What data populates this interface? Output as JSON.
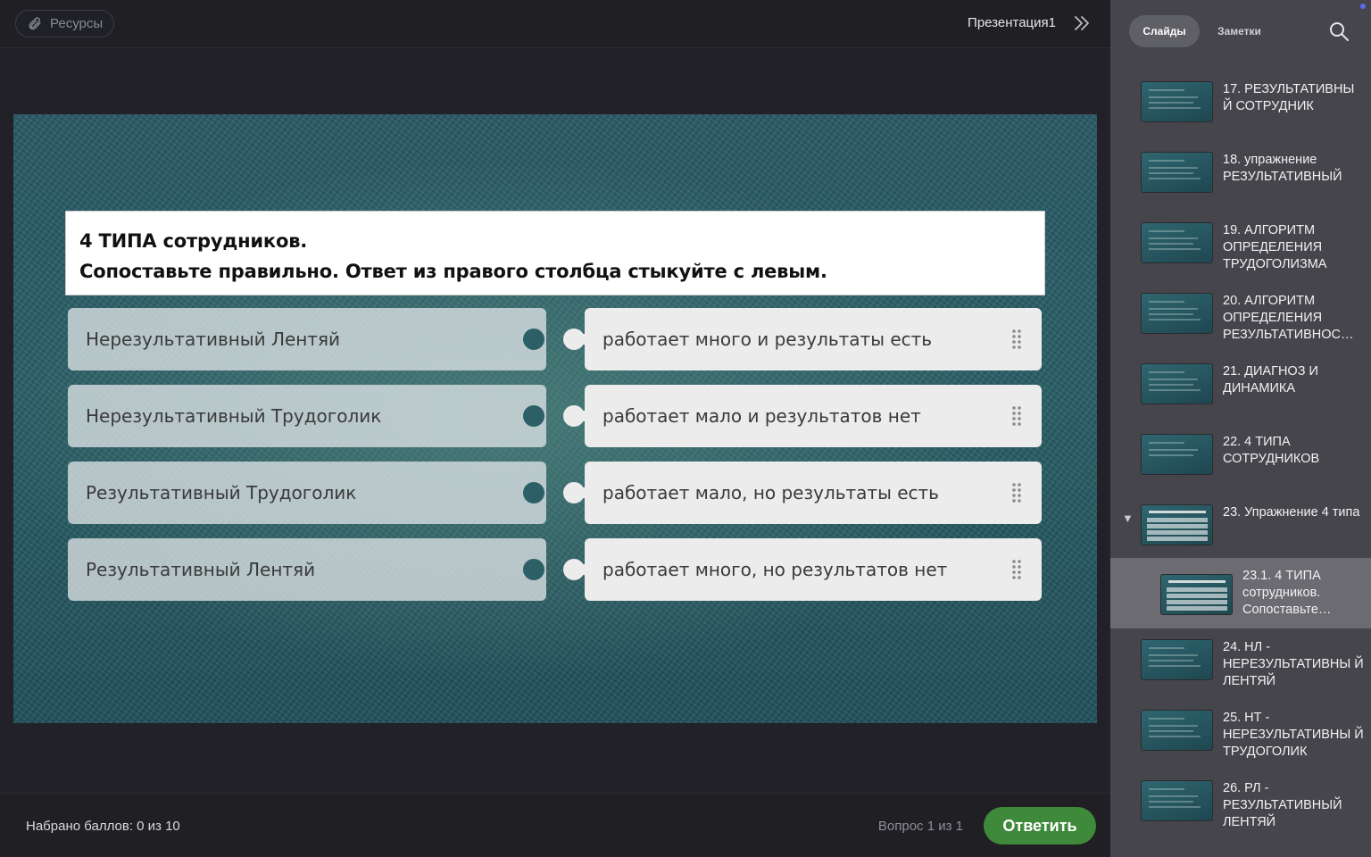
{
  "topbar": {
    "resources_label": "Ресурсы",
    "resources_icon": "paperclip-icon",
    "presentation_title": "Презентация1",
    "collapse_icon": "double-chevron-right-icon"
  },
  "question": {
    "line1": "4 ТИПА сотрудников.",
    "line2": "Сопоставьте правильно. Ответ из правого столбца стыкуйте с левым."
  },
  "matching": {
    "left": [
      "Нерезультативный Лентяй",
      "Нерезультативный Трудоголик",
      "Результативный Трудоголик",
      "Результативный Лентяй"
    ],
    "right": [
      "работает много и результаты есть",
      "работает мало и результатов нет",
      "работает мало, но результаты есть",
      "работает много, но результатов нет"
    ]
  },
  "bottombar": {
    "score": "Набрано баллов: 0 из 10",
    "question_count": "Вопрос 1 из 1",
    "answer_button": "Ответить"
  },
  "sidebar": {
    "tab_slides": "Слайды",
    "tab_notes": "Заметки",
    "search_icon": "search-icon",
    "slides": [
      {
        "label": "17. РЕЗУЛЬТАТИВНЫ Й СОТРУДНИК"
      },
      {
        "label": "18. упражнение РЕЗУЛЬТАТИВНЫЙ"
      },
      {
        "label": "19. АЛГОРИТМ ОПРЕДЕЛЕНИЯ ТРУДОГОЛИЗМА"
      },
      {
        "label": "20. АЛГОРИТМ ОПРЕДЕЛЕНИЯ РЕЗУЛЬТАТИВНОС…"
      },
      {
        "label": "21. ДИАГНОЗ И ДИНАМИКА"
      },
      {
        "label": "22. 4 ТИПА СОТРУДНИКОВ"
      },
      {
        "label": "23. Упражнение 4 типа"
      },
      {
        "label": "23.1. 4 ТИПА сотрудников. Сопоставьте…"
      },
      {
        "label": "24. НЛ - НЕРЕЗУЛЬТАТИВНЫ Й ЛЕНТЯЙ"
      },
      {
        "label": "25. НТ - НЕРЕЗУЛЬТАТИВНЫ Й ТРУДОГОЛИК"
      },
      {
        "label": "26. РЛ - РЕЗУЛЬТАТИВНЫЙ ЛЕНТЯЙ"
      }
    ]
  },
  "colors": {
    "accent_green": "#3f8a3a",
    "sidebar_bg": "#45454b",
    "selected_item_bg": "#6b6b71"
  }
}
